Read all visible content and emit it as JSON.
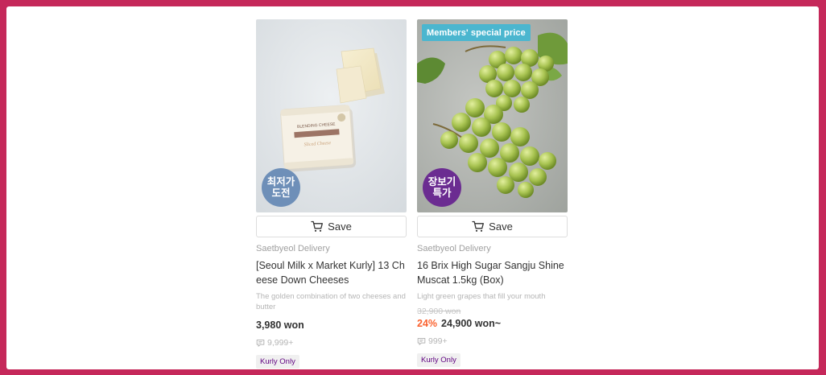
{
  "products": [
    {
      "brand": "Saetbyeol Delivery",
      "title": "[Seoul Milk x Market Kurly] 13 Cheese Down Cheeses",
      "description": "The golden combination of two cheeses and butter",
      "promo_tag": "",
      "sticker_line1": "최저가",
      "sticker_line2": "도전",
      "original_price": "",
      "discount": "",
      "price": "3,980 won",
      "reviews": "9,999+",
      "badge": "Kurly Only",
      "save_label": "Save",
      "image_icon": "cheese-slices"
    },
    {
      "brand": "Saetbyeol Delivery",
      "title": "16 Brix High Sugar Sangju Shine Muscat 1.5kg (Box)",
      "description": "Light green grapes that fill your mouth",
      "promo_tag": "Members' special price",
      "sticker_line1": "장보기",
      "sticker_line2": "특가",
      "original_price": "32,900 won",
      "discount": "24%",
      "price": "24,900 won~",
      "reviews": "999+",
      "badge": "Kurly Only",
      "save_label": "Save",
      "image_icon": "green-grapes"
    }
  ],
  "colors": {
    "frame": "#c5285a",
    "discount": "#fa622f",
    "badge_text": "#5f0080",
    "promo_tag_bg": "#4bb6cf",
    "sticker_blue": "#6e8fb8",
    "sticker_purple": "#6b2c91"
  }
}
